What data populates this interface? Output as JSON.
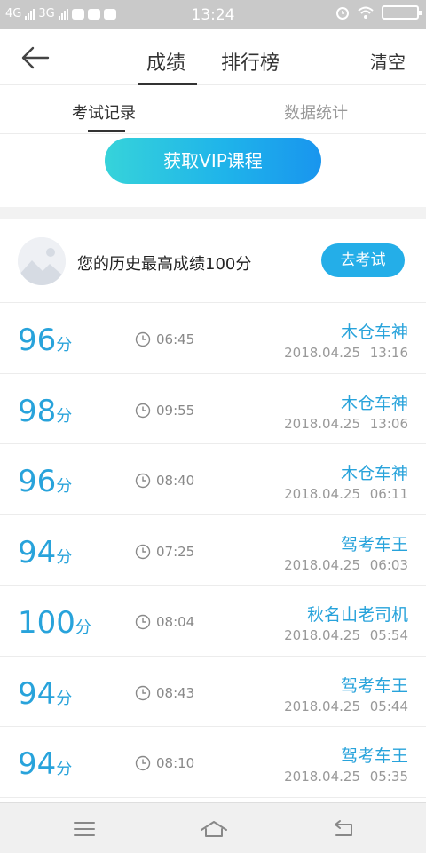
{
  "status_bar": {
    "network_1": "4G",
    "network_2": "3G",
    "time": "13:24"
  },
  "nav": {
    "tabs": [
      {
        "label": "成绩",
        "active": true
      },
      {
        "label": "排行榜",
        "active": false
      }
    ],
    "clear_label": "清空"
  },
  "sub_tabs": [
    {
      "label": "考试记录",
      "active": true
    },
    {
      "label": "数据统计",
      "active": false
    }
  ],
  "vip": {
    "label": "获取VIP课程"
  },
  "best": {
    "text": "您的历史最高成绩100分",
    "button_label": "去考试"
  },
  "records": [
    {
      "score": "96",
      "unit": "分",
      "duration": "06:45",
      "name": "木仓车神",
      "date": "2018.04.25 13:16"
    },
    {
      "score": "98",
      "unit": "分",
      "duration": "09:55",
      "name": "木仓车神",
      "date": "2018.04.25 13:06"
    },
    {
      "score": "96",
      "unit": "分",
      "duration": "08:40",
      "name": "木仓车神",
      "date": "2018.04.25 06:11"
    },
    {
      "score": "94",
      "unit": "分",
      "duration": "07:25",
      "name": "驾考车王",
      "date": "2018.04.25 06:03"
    },
    {
      "score": "100",
      "unit": "分",
      "duration": "08:04",
      "name": "秋名山老司机",
      "date": "2018.04.25 05:54"
    },
    {
      "score": "94",
      "unit": "分",
      "duration": "08:43",
      "name": "驾考车王",
      "date": "2018.04.25 05:44"
    },
    {
      "score": "94",
      "unit": "分",
      "duration": "08:10",
      "name": "驾考车王",
      "date": "2018.04.25 05:35"
    }
  ],
  "colors": {
    "accent": "#28a3db",
    "button_blue": "#24aee8",
    "vip_gradient_start": "#36d3da",
    "vip_gradient_end": "#1995ee"
  }
}
